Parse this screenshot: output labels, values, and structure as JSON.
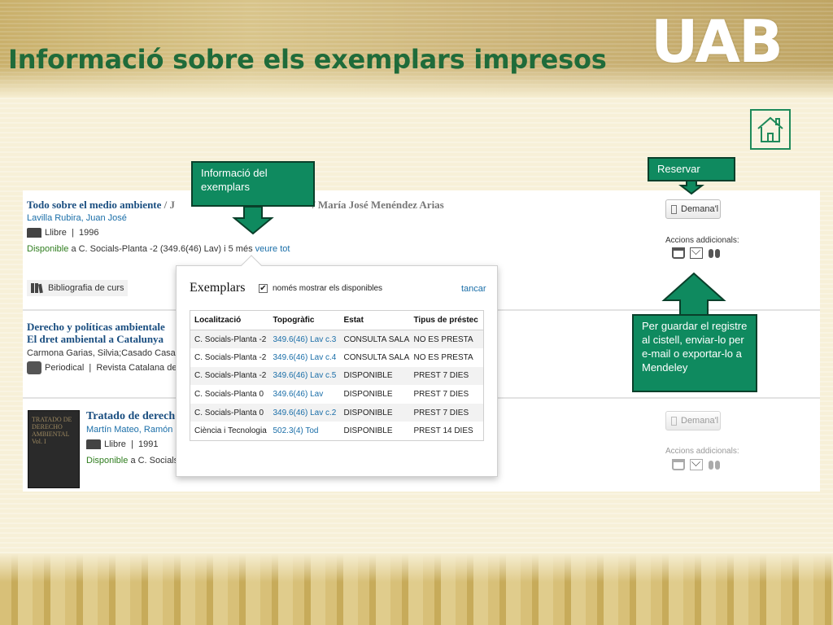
{
  "page": {
    "title": "Informació sobre els exemplars impresos",
    "logo_text": "UAB"
  },
  "results": [
    {
      "title": "Todo sobre el medio ambiente",
      "author_tail": "/ J",
      "author_tail2": "/ María José Menéndez Arias",
      "authors": "Lavilla Rubira, Juan José",
      "format": "Llibre",
      "year": "1996",
      "availability_status": "Disponible",
      "availability_text": "a C. Socials-Planta -2 (349.6(46) Lav) i 5 més",
      "see_all": "veure tot",
      "bibliography": "Bibliografia de curs",
      "request_button": "Demana'l",
      "additional_actions": "Accions addicionals:"
    },
    {
      "title_line1": "Derecho y políticas ambientale",
      "title_line2": "El dret ambiental a Catalunya",
      "authors": "Carmona Garias, Silvia;Casado Casado, I",
      "format": "Periodical",
      "journal": "Revista Catalana de D"
    },
    {
      "title": "Tratado de derech",
      "authors": "Martín Mateo, Ramón",
      "format": "Llibre",
      "year": "1991",
      "availability_status": "Disponible",
      "availability_text": "a C. Socials-P",
      "request_button": "Demana'l",
      "additional_actions": "Accions addicionals:",
      "cover_text": "TRATADO DE DERECHO AMBIENTAL Vol. I"
    }
  ],
  "popup": {
    "heading": "Exemplars",
    "filter_checked": "✔",
    "filter_label": "només mostrar els disponibles",
    "close": "tancar",
    "columns": [
      "Localització",
      "Topogràfic",
      "Estat",
      "Tipus de préstec"
    ],
    "rows": [
      [
        "C. Socials-Planta -2",
        "349.6(46) Lav c.3",
        "CONSULTA SALA",
        "NO ES PRESTA"
      ],
      [
        "C. Socials-Planta -2",
        "349.6(46) Lav c.4",
        "CONSULTA SALA",
        "NO ES PRESTA"
      ],
      [
        "C. Socials-Planta -2",
        "349.6(46) Lav c.5",
        "DISPONIBLE",
        "PREST 7 DIES"
      ],
      [
        "C. Socials-Planta 0",
        "349.6(46) Lav",
        "DISPONIBLE",
        "PREST 7 DIES"
      ],
      [
        "C. Socials-Planta 0",
        "349.6(46) Lav c.2",
        "DISPONIBLE",
        "PREST 7 DIES"
      ],
      [
        "Ciència i Tecnologia",
        "502.3(4) Tod",
        "DISPONIBLE",
        "PREST 14 DIES"
      ]
    ]
  },
  "callouts": {
    "exemplars": "Informació del exemplars",
    "reservar": "Reservar",
    "accions": "Per guardar el registre al cistell, enviar-lo per e-mail o exportar-lo a Mendeley"
  },
  "colors": {
    "title_green": "#1f6b3a",
    "callout_green": "#0f8a5f",
    "link_blue": "#1a6ea8",
    "available_green": "#2f7d1e"
  }
}
